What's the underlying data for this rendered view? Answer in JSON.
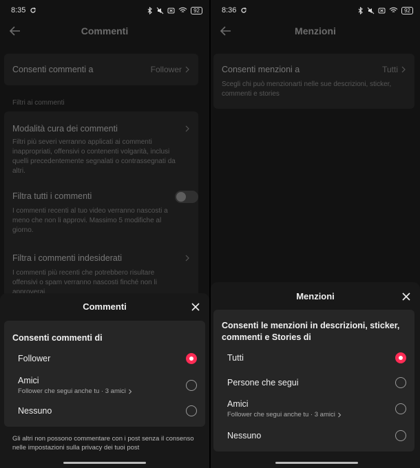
{
  "left": {
    "status": {
      "time": "8:35",
      "battery": "92"
    },
    "header": {
      "title": "Commenti"
    },
    "main": {
      "allow_row": {
        "label": "Consenti commenti a",
        "value": "Follower"
      },
      "filters_section_title": "Filtri ai commenti",
      "curation": {
        "label": "Modalità cura dei commenti",
        "desc": "Filtri più severi verranno applicati ai commenti inappropriati, offensivi o contenenti volgarità, inclusi quelli precedentemente segnalati o contrassegnati da altri."
      },
      "filter_all": {
        "label": "Filtra tutti i commenti",
        "desc": "I commenti recenti al tuo video verranno nascosti a meno che non li approvi. Massimo 5 modifiche al giorno."
      },
      "filter_unwanted": {
        "label": "Filtra i commenti indesiderati",
        "desc": "I commenti più recenti che potrebbero risultare offensivi o spam verranno nascosti finché non li approverai."
      }
    },
    "sheet": {
      "title": "Commenti",
      "heading": "Consenti commenti di",
      "options": [
        {
          "label": "Follower",
          "sub": "",
          "selected": true
        },
        {
          "label": "Amici",
          "sub": "Follower che segui anche tu · 3 amici",
          "selected": false
        },
        {
          "label": "Nessuno",
          "sub": "",
          "selected": false
        }
      ],
      "footnote": "Gli altri non possono commentare con i post senza il consenso nelle impostazioni sulla privacy dei tuoi post"
    }
  },
  "right": {
    "status": {
      "time": "8:36",
      "battery": "92"
    },
    "header": {
      "title": "Menzioni"
    },
    "main": {
      "allow_row": {
        "label": "Consenti menzioni a",
        "value": "Tutti",
        "desc": "Scegli chi può menzionarti nelle sue descrizioni, sticker, commenti e stories"
      }
    },
    "sheet": {
      "title": "Menzioni",
      "heading": "Consenti le menzioni in descrizioni, sticker, commenti e Stories di",
      "options": [
        {
          "label": "Tutti",
          "sub": "",
          "selected": true
        },
        {
          "label": "Persone che segui",
          "sub": "",
          "selected": false
        },
        {
          "label": "Amici",
          "sub": "Follower che segui anche tu · 3 amici",
          "selected": false
        },
        {
          "label": "Nessuno",
          "sub": "",
          "selected": false
        }
      ]
    }
  },
  "colors": {
    "accent": "#fe2c55",
    "background": "#121212",
    "card": "#262626"
  }
}
